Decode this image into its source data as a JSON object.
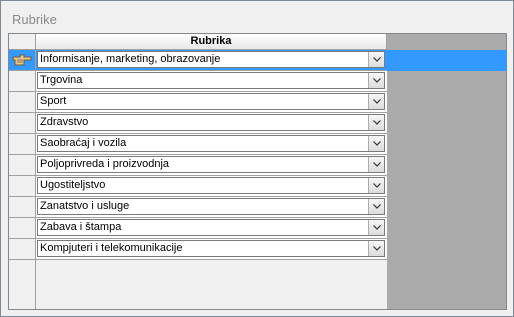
{
  "window": {
    "title": "Rubrike"
  },
  "grid": {
    "column_header": "Rubrika",
    "selected_color": "#3399ff",
    "rows": [
      {
        "value": "Informisanje, marketing, obrazovanje",
        "selected": true
      },
      {
        "value": "Trgovina",
        "selected": false
      },
      {
        "value": "Sport",
        "selected": false
      },
      {
        "value": "Zdravstvo",
        "selected": false
      },
      {
        "value": "Saobraćaj i vozila",
        "selected": false
      },
      {
        "value": "Poljoprivreda i proizvodnja",
        "selected": false
      },
      {
        "value": "Ugostiteljstvo",
        "selected": false
      },
      {
        "value": "Zanatstvo i usluge",
        "selected": false
      },
      {
        "value": "Zabava i štampa",
        "selected": false
      },
      {
        "value": "Kompjuteri i telekomunikacije",
        "selected": false
      }
    ],
    "current_row_icon": "pointing-hand-icon",
    "dropdown_icon": "chevron-down-icon"
  }
}
